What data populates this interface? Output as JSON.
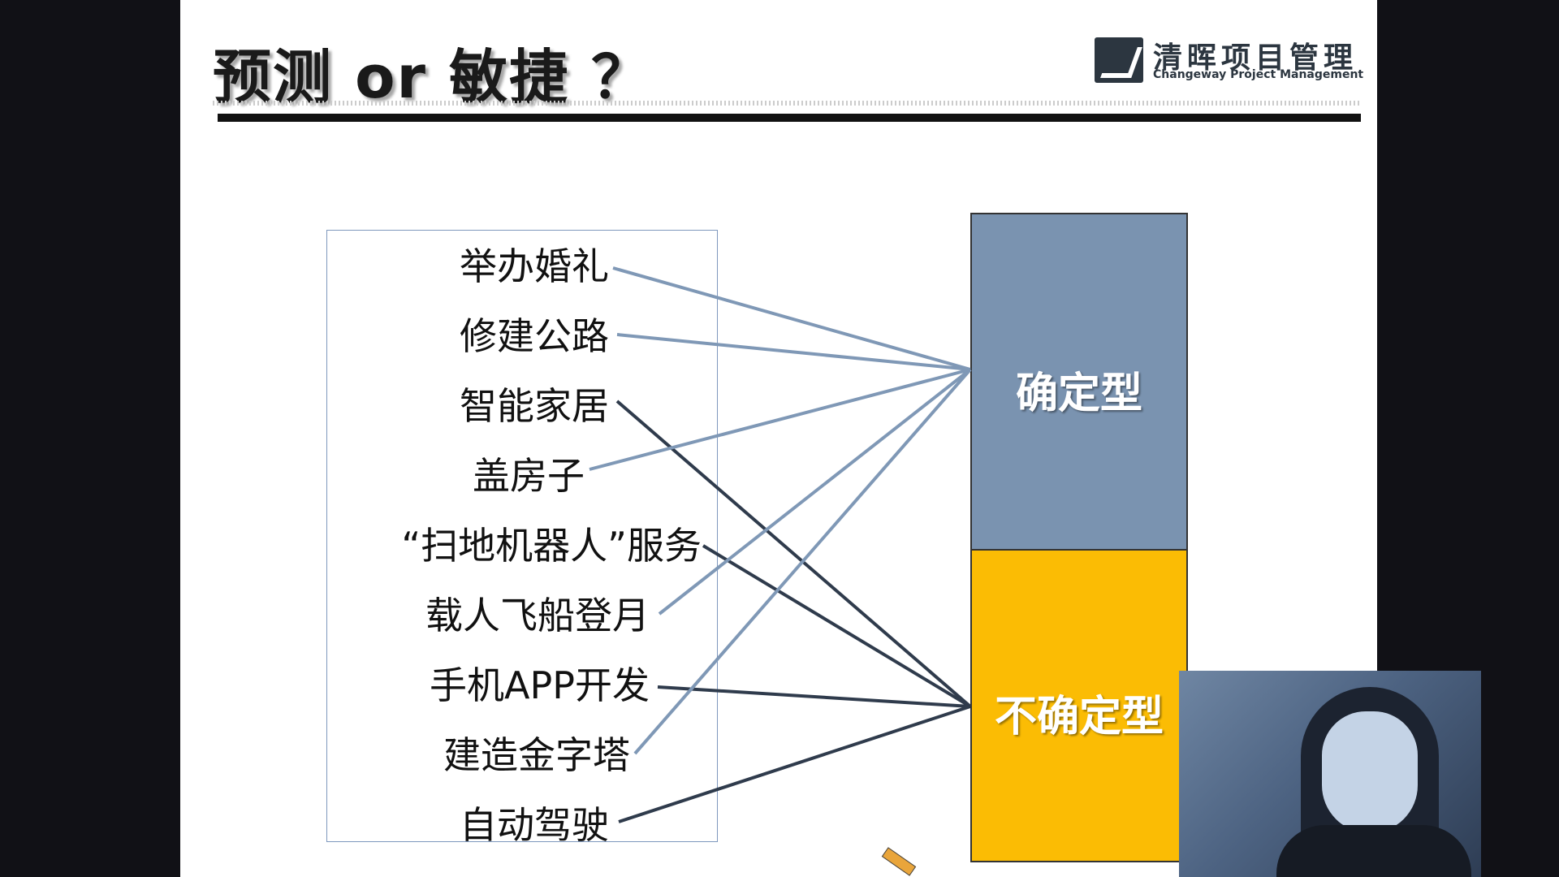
{
  "slide": {
    "title": "预测 or 敏捷 ？",
    "logo": {
      "name_cn": "清晖项目管理",
      "name_en": "Changeway Project Management"
    }
  },
  "items": [
    {
      "label": "举办婚礼",
      "category": "certain"
    },
    {
      "label": "修建公路",
      "category": "certain"
    },
    {
      "label": "智能家居",
      "category": "uncertain"
    },
    {
      "label": "盖房子",
      "category": "certain"
    },
    {
      "label": "“扫地机器人”服务",
      "category": "uncertain"
    },
    {
      "label": "载人飞船登月",
      "category": "certain"
    },
    {
      "label": "手机APP开发",
      "category": "uncertain"
    },
    {
      "label": "建造金字塔",
      "category": "certain"
    },
    {
      "label": "自动驾驶",
      "category": "uncertain"
    }
  ],
  "categories": {
    "certain": {
      "label": "确定型",
      "color": "#7a93b0"
    },
    "uncertain": {
      "label": "不确定型",
      "color": "#fbbc04"
    }
  },
  "colors": {
    "line_certain": "#7f98b6",
    "line_uncertain": "#2f3b4c"
  }
}
